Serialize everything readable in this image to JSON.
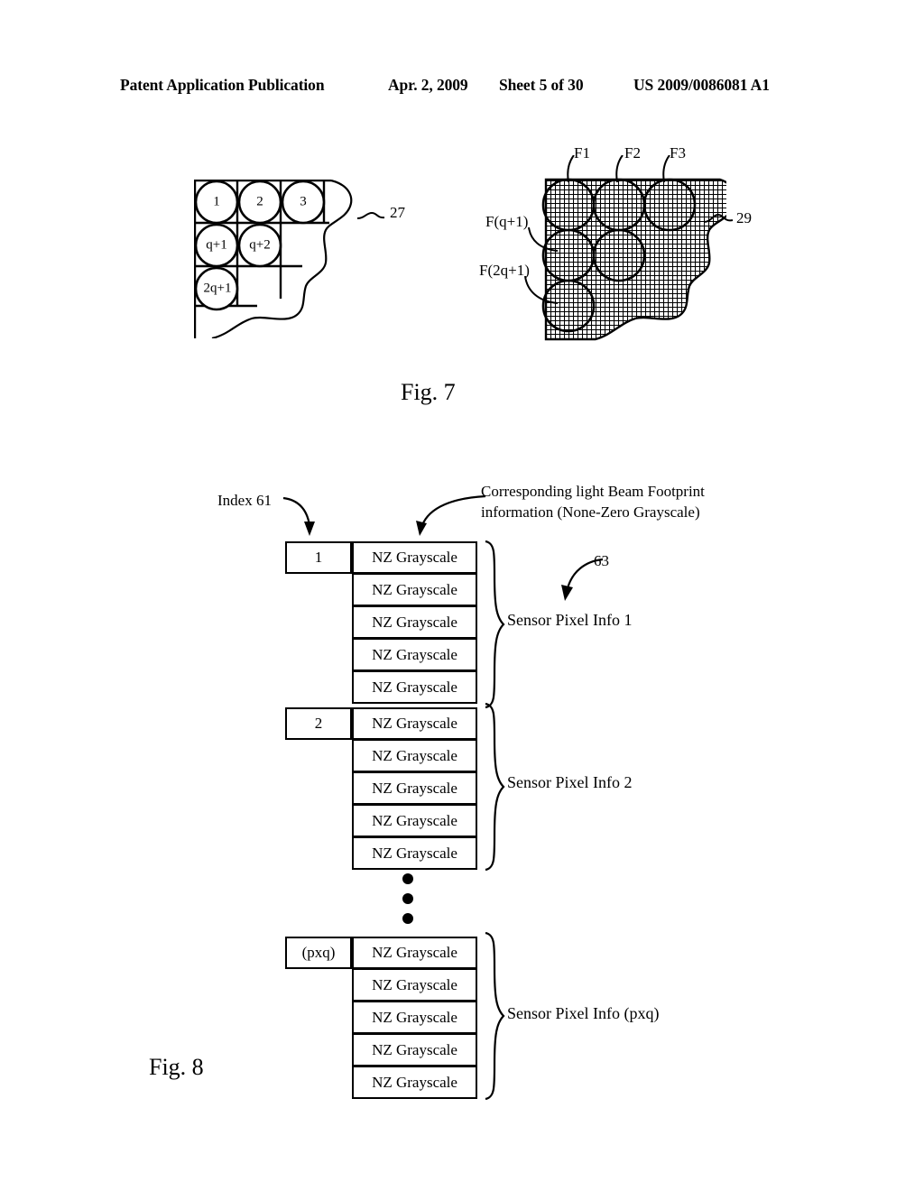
{
  "header": {
    "publication": "Patent Application Publication",
    "date": "Apr. 2, 2009",
    "sheet": "Sheet 5 of 30",
    "number": "US 2009/0086081 A1"
  },
  "figures": [
    {
      "caption": "Fig. 7",
      "left_diagram": {
        "reference": "27",
        "grid": {
          "columns": 4,
          "rows": 4
        },
        "circle_labels": [
          "1",
          "2",
          "3",
          "q+1",
          "q+2",
          "2q+1"
        ]
      },
      "right_diagram": {
        "reference": "29",
        "beam_labels": [
          "F1",
          "F2",
          "F3",
          "F(q+1)",
          "F(2q+1)"
        ]
      }
    },
    {
      "caption": "Fig. 8",
      "annotations": {
        "index": "Index 61",
        "corresponding": "Corresponding light Beam Footprint information (None-Zero Grayscale)",
        "reference": "63"
      },
      "table": {
        "cell_text": "NZ Grayscale",
        "groups": [
          {
            "index": "1",
            "rows": 5,
            "brace_label": "Sensor Pixel Info 1"
          },
          {
            "index": "2",
            "rows": 5,
            "brace_label": "Sensor Pixel Info 2"
          },
          {
            "index": "(pxq)",
            "rows": 5,
            "brace_label": "Sensor Pixel Info (pxq)"
          }
        ],
        "ellipsis": "⋮"
      }
    }
  ],
  "colors": {
    "ink": "#000000",
    "paper": "#ffffff"
  }
}
